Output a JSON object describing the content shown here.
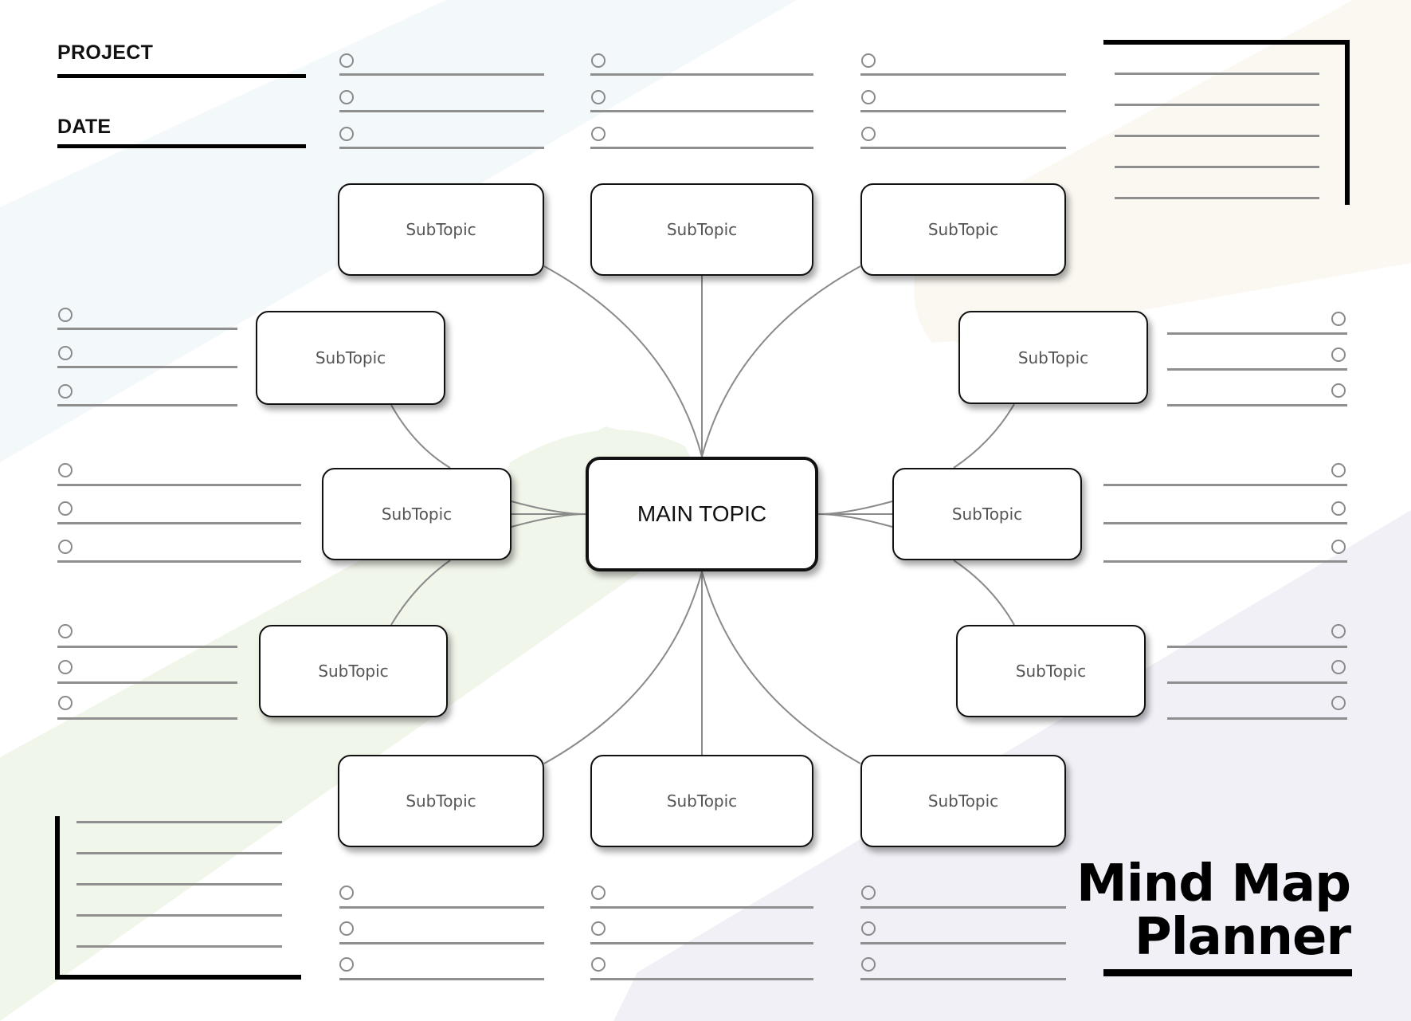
{
  "header": {
    "project_label": "PROJECT",
    "date_label": "DATE",
    "project_value": "",
    "date_value": ""
  },
  "main_topic": "MAIN TOPIC",
  "subtopics": [
    "SubTopic",
    "SubTopic",
    "SubTopic",
    "SubTopic",
    "SubTopic",
    "SubTopic",
    "SubTopic",
    "SubTopic",
    "SubTopic",
    "SubTopic",
    "SubTopic",
    "SubTopic"
  ],
  "title": {
    "line1": "Mind Map",
    "line2": "Planner"
  },
  "checklist_items_per_group": 3,
  "note_lines_per_corner": 5,
  "colors": {
    "background": "#ffffff",
    "band_blue": "#f3f8fa",
    "band_green": "#f1f6ea",
    "band_cream": "#fbf8f1",
    "band_lavender": "#f1f0f7",
    "line_gray": "#8f8f8f",
    "ink": "#000000"
  }
}
